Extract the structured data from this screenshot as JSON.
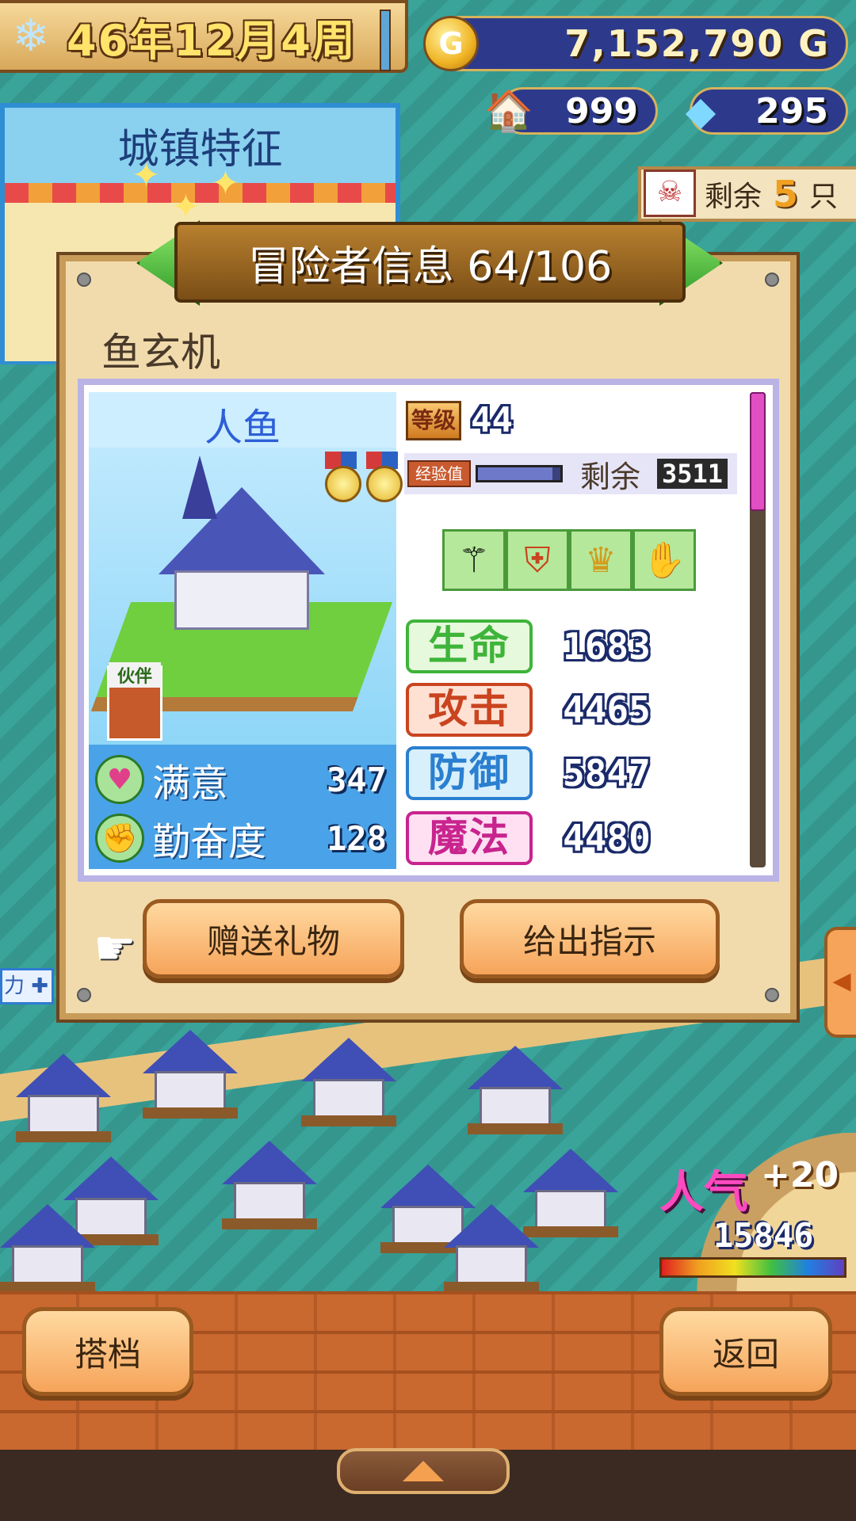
{
  "hud": {
    "date": "46年12月4周",
    "gold": "7,152,790 G",
    "gold_icon_letter": "G",
    "houses": "999",
    "crystals": "295",
    "remain": {
      "label": "剩余",
      "count": "5",
      "unit": "只"
    }
  },
  "feature_panel": {
    "title": "城镇特征"
  },
  "dialog": {
    "title": "冒险者信息 64/106",
    "name": "鱼玄机",
    "species": "人鱼",
    "partner_label": "伙伴",
    "satisfaction": {
      "label": "满意",
      "value": "347"
    },
    "diligence": {
      "label": "勤奋度",
      "value": "128"
    },
    "level": {
      "badge": "等级",
      "value": "44"
    },
    "exp": {
      "badge": "经验值",
      "remain_label": "剩余",
      "remain_value": "3511",
      "progress": 0.9
    },
    "equipment": [
      "staff-icon",
      "armor-icon",
      "crown-icon",
      "gauntlet-icon"
    ],
    "stats": [
      {
        "label": "生命",
        "value": "1683",
        "color": "#3fb43a",
        "bg": "#e6f9dc"
      },
      {
        "label": "攻击",
        "value": "4465",
        "color": "#c9441f",
        "bg": "#ffe1d4"
      },
      {
        "label": "防御",
        "value": "5847",
        "color": "#2a7fd0",
        "bg": "#d8f0fc"
      },
      {
        "label": "魔法",
        "value": "4480",
        "color": "#c8248e",
        "bg": "#ffe0f2"
      }
    ],
    "gift_button": "赠送礼物",
    "instruct_button": "给出指示"
  },
  "left_tag": "力",
  "popularity": {
    "label": "人气",
    "delta": "+20",
    "value": "15846"
  },
  "bottom": {
    "partner_button": "搭档",
    "back_button": "返回"
  }
}
